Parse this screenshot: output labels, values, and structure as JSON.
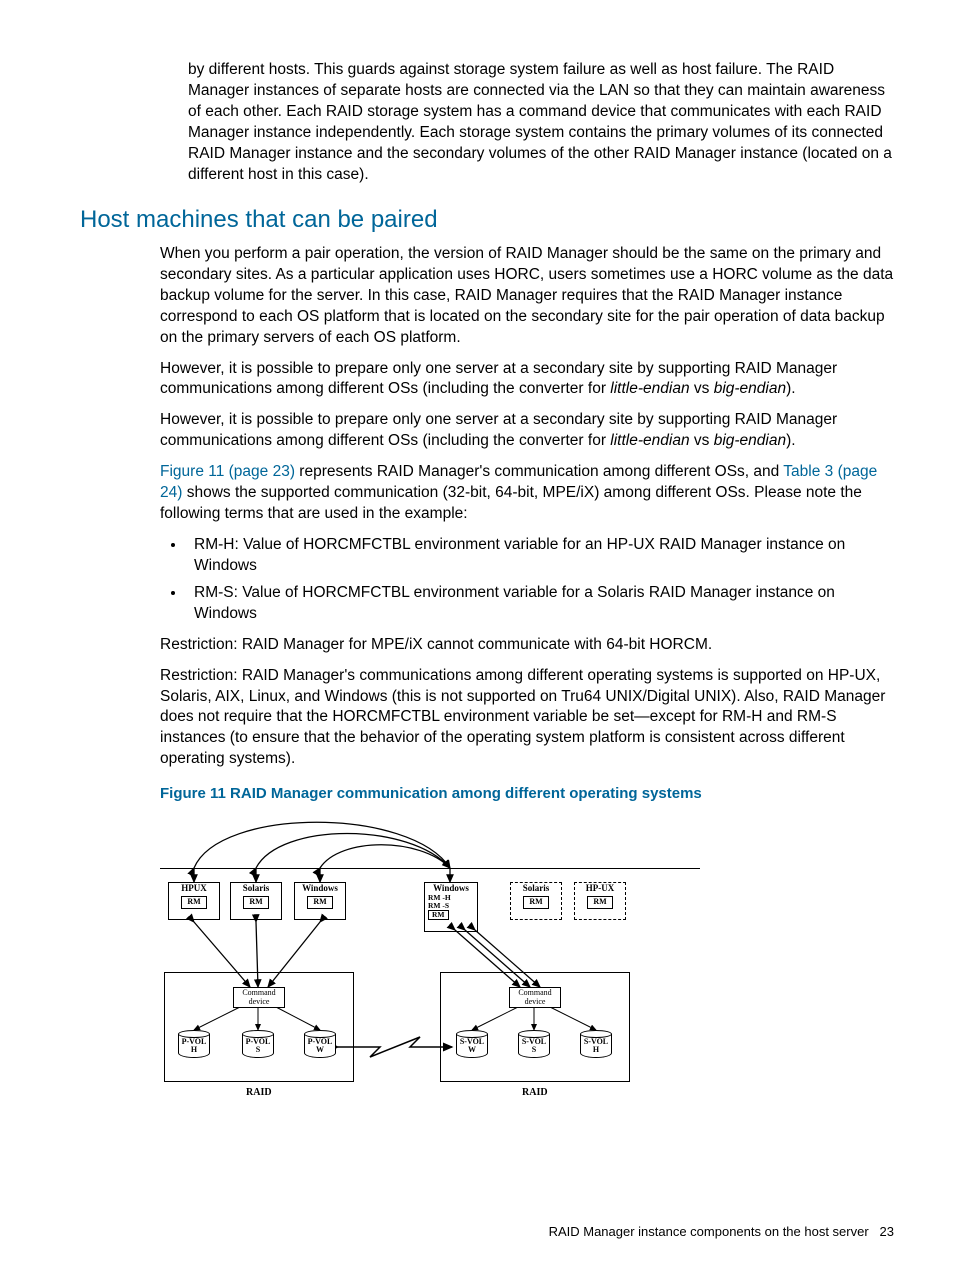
{
  "intro_para": "by different hosts. This guards against storage system failure as well as host failure. The RAID Manager instances of separate hosts are connected via the LAN so that they can maintain awareness of each other. Each RAID storage system has a command device that communicates with each RAID Manager instance independently. Each storage system contains the primary volumes of its connected RAID Manager instance and the secondary volumes of the other RAID Manager instance (located on a different host in this case).",
  "heading": "Host machines that can be paired",
  "p1": "When you perform a pair operation, the version of RAID Manager should be the same on the primary and secondary sites. As a particular application uses HORC, users sometimes use a HORC volume as the data backup volume for the server. In this case, RAID Manager requires that the RAID Manager instance correspond to each OS platform that is located on the secondary site for the pair operation of data backup on the primary servers of each OS platform.",
  "p2_a": "However, it is possible to prepare only one server at a secondary site by supporting RAID Manager communications among different OSs (including the converter for ",
  "p2_b": "little-endian",
  "p2_c": " vs ",
  "p2_d": "big-endian",
  "p2_e": ").",
  "p3_a": "However, it is possible to prepare only one server at a secondary site by supporting RAID Manager communications among different OSs (including the converter for ",
  "p3_b": "little-endian",
  "p3_c": " vs ",
  "p3_d": "big-endian",
  "p3_e": ").",
  "p4_link1": "Figure 11 (page 23)",
  "p4_mid": " represents RAID Manager's communication among different OSs, and ",
  "p4_link2": "Table 3 (page 24)",
  "p4_end": " shows the supported communication (32-bit, 64-bit, MPE/iX) among different OSs. Please note the following terms that are used in the example:",
  "bullet1": "RM-H: Value of HORCMFCTBL environment variable for an HP-UX RAID Manager instance on Windows",
  "bullet2": "RM-S: Value of HORCMFCTBL environment variable for a Solaris RAID Manager instance on Windows",
  "p5": "Restriction: RAID Manager for MPE/iX cannot communicate with 64-bit HORCM.",
  "p6": "Restriction: RAID Manager's communications among different operating systems is supported on HP-UX, Solaris, AIX, Linux, and Windows (this is not supported on Tru64 UNIX/Digital UNIX). Also, RAID Manager does not require that the HORCMFCTBL environment variable be set—except for RM-H and RM-S instances (to ensure that the behavior of the operating system platform is consistent across different operating systems).",
  "figure_title": "Figure 11 RAID Manager communication among different operating systems",
  "diagram": {
    "hosts_left": [
      "HPUX",
      "Solaris",
      "Windows"
    ],
    "host_mid": {
      "name": "Windows",
      "rms": [
        "RM -H",
        "RM -S",
        "RM"
      ]
    },
    "hosts_right": [
      "Solaris",
      "HP-UX"
    ],
    "rm": "RM",
    "cmd": "Command device",
    "pvols": [
      {
        "t": "P-VOL",
        "s": "H"
      },
      {
        "t": "P-VOL",
        "s": "S"
      },
      {
        "t": "P-VOL",
        "s": "W"
      }
    ],
    "svols": [
      {
        "t": "S-VOL",
        "s": "W"
      },
      {
        "t": "S-VOL",
        "s": "S"
      },
      {
        "t": "S-VOL",
        "s": "H"
      }
    ],
    "raid": "RAID"
  },
  "footer_text": "RAID Manager instance components on the host server",
  "footer_page": "23"
}
